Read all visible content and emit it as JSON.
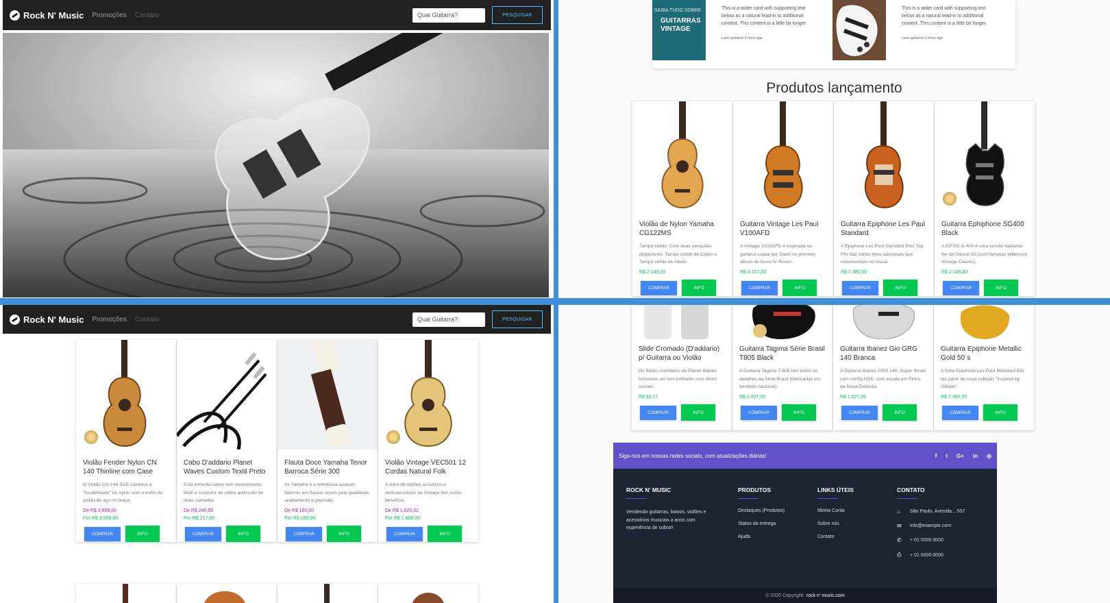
{
  "nav": {
    "brand": "Rock N' Music",
    "links": [
      "Promoções",
      "Contato"
    ],
    "search_placeholder": "Qual Guitarra?",
    "search_button": "PESQUISAR"
  },
  "wide_cards": [
    {
      "image_label_top": "SAIBA TUDO SOBRE",
      "image_label_main": "GUITARRAS VINTAGE",
      "text": "This is a wider card with supporting text below as a natural lead-in to additional content. This content is a little bit longer.",
      "updated": "Last updated 3 mins ago"
    },
    {
      "text": "This is a wider card with supporting text below as a natural lead-in to additional content. This content is a little bit longer.",
      "updated": "Last updated 3 mins ago"
    }
  ],
  "launch_title": "Produtos lançamento",
  "launch_products": [
    {
      "name": "Violão de Nylon Yamaha CG122MS",
      "desc": "Tampo sólido. Com duas variações disponíveis: Tampo sólido de Cedro e Tampo sólido de Abeto.",
      "price": "R$ 2.143,00"
    },
    {
      "name": "Guitarra Vintage Les Paul V100AFD",
      "desc": "A Vintage V100AFD é inspirada na guitarra usada por Slash no primeiro álbum do Guns N' Roses.",
      "price": "R$ 4.107,00"
    },
    {
      "name": "Guitarra Epiphone Les Paul Standard",
      "desc": "A Epiphone Les Paul Standard Plus Top Pro traz vários itens adicionais que incrementam no visual.",
      "price": "R$ 7.380,00"
    },
    {
      "name": "Guitarra Ephiphone SG400 Black",
      "desc": "A EP SG G-400 é uma versão bastante fiel da Gibson 62 (com tarraxas Wilkinson Vintage Classic).",
      "price": "R$ 2.143,00"
    }
  ],
  "promo_products": [
    {
      "name": "Violão Fender Nylon CN 140 Thinline com Case",
      "desc": "O Violão CN-140 SCE combina a \"tocabilidade\" do nylon com o estilo do violão de aço no braço.",
      "old_price": "De R$ 3.699,00",
      "price": "Por R$ 3.099,00"
    },
    {
      "name": "Cabo D'addario Planet Waves Custom Textil Preto",
      "desc": "Esta linha de cabos tem revestimento têxtil e condutor de cobre antirruído de duas camadas.",
      "old_price": "De R$ 240,00",
      "price": "Por R$ 217,00"
    },
    {
      "name": "Flauta Doce Yamaha Tenor Barroca Série 300",
      "desc": "As Yamaha é a referência quando falamos em flautas doces pela qualidade, acabamento e precisão.",
      "old_price": "De R$ 180,00",
      "price": "Por R$ 160,00"
    },
    {
      "name": "Violão Vintage VEC501 12 Cordas Natural Folk",
      "desc": "A linha de violões acústicos e eletroacústicos da Vintage tem custo-benefício.",
      "old_price": "De R$ 1.820,02",
      "price": "Por R$ 1.699,00"
    }
  ],
  "more_products": [
    {
      "name": "Slide Cromado (D'addario) p/ Guitarra ou Violão",
      "desc": "Os Slides cromados da Planet Waves fornecem um tom brilhante com ótimo sustain.",
      "price": "R$ 92,17"
    },
    {
      "name": "Guitarra Tagima Série Brasil T805 Black",
      "desc": "A Guitarra Tagima T-805 tem todos os detalhes da Série Brazil (fabricadas em território nacional).",
      "price": "R$ 2.927,00"
    },
    {
      "name": "Guitarra Ibanez Gio GRG 140 Branca",
      "desc": "A Guitarra Ibanez GRG 140, Super Strato com config HSS, com escala em Pinho da Nova Zelândia.",
      "price": "R$ 1.927,00"
    },
    {
      "name": "Guitarra Epiphone Metallic Gold 50´s",
      "desc": "A linha Epiphone Les Paul Standard 50s faz parte da nova coleção \"Inspired by Gibson\".",
      "price": "R$ 7.380,00"
    }
  ],
  "buttons": {
    "buy": "COMPRAR",
    "info": "INFO"
  },
  "footer": {
    "social_text": "Siga-nos em nossas redes sociais, com atualizações diárias!",
    "social_icons": [
      "f",
      "t",
      "G+",
      "in",
      "◎"
    ],
    "about_title": "ROCK N' MUSIC",
    "about_text": "Vendendo guitarras, baixos, violões e acessórios musicais a anos com esperiência de sobra!!",
    "products_title": "PRODUTOS",
    "products_links": [
      "Destaques (Produtos)",
      "Status da entrega",
      "Ajuda"
    ],
    "useful_title": "LINKS ÚTEIS",
    "useful_links": [
      "Minha Conta",
      "Sobre nós",
      "Contato"
    ],
    "contact_title": "CONTATO",
    "contact_items": [
      "São Paulo, Avenida... 537",
      "info@example.com",
      "+ 01 0000 0000",
      "+ 01 0000 0000"
    ],
    "copyright_prefix": "© 2020 Copyright:",
    "copyright_site": "rock n' music.com"
  },
  "colors": {
    "accent": "#4285f4",
    "success": "#00c851",
    "purple": "#6051c9",
    "navbar": "#212121",
    "footer": "#1c2331"
  }
}
